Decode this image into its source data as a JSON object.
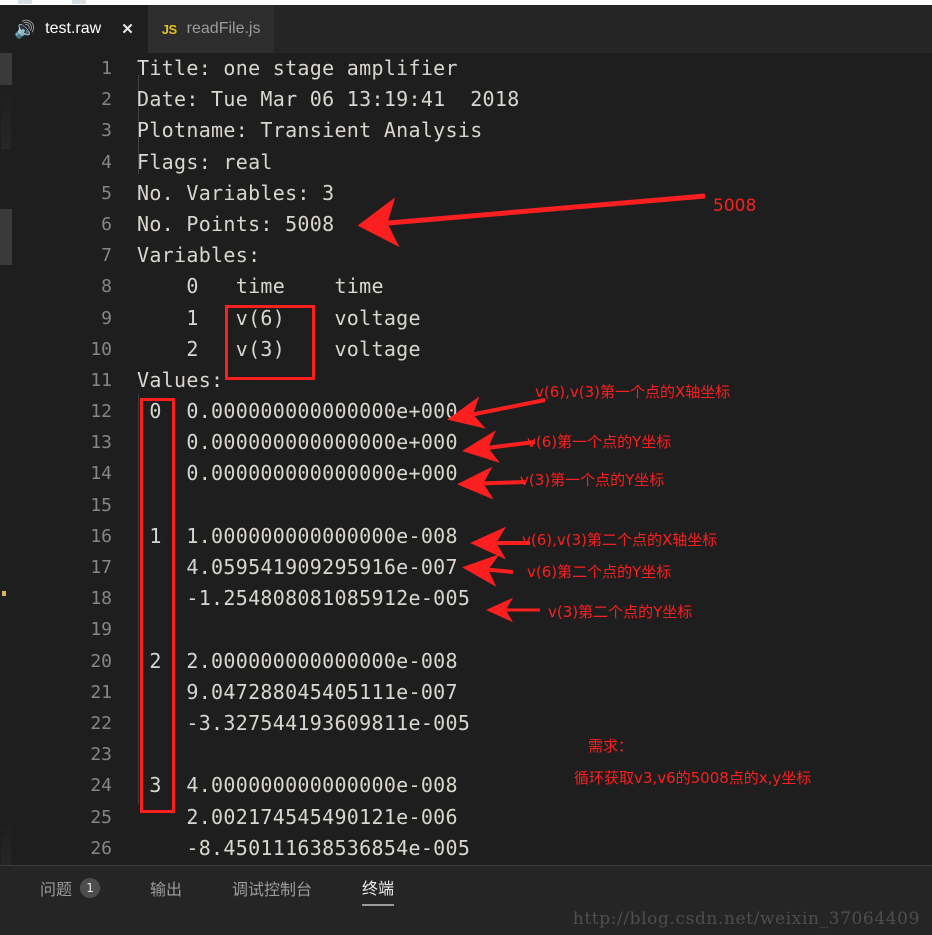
{
  "window": {
    "tabs": [
      {
        "label": "test.raw",
        "icon": "speaker-icon",
        "active": true,
        "close": "✕"
      },
      {
        "label": "readFile.js",
        "icon": "js-icon",
        "icon_text": "JS",
        "active": false
      }
    ]
  },
  "editor": {
    "lines": [
      {
        "no": "1",
        "text": "Title: one stage amplifier"
      },
      {
        "no": "2",
        "text": "Date: Tue Mar 06 13:19:41  2018"
      },
      {
        "no": "3",
        "text": "Plotname: Transient Analysis"
      },
      {
        "no": "4",
        "text": "Flags: real"
      },
      {
        "no": "5",
        "text": "No. Variables: 3"
      },
      {
        "no": "6",
        "text": "No. Points: 5008"
      },
      {
        "no": "7",
        "text": "Variables:"
      },
      {
        "no": "8",
        "text": "    0   time    time"
      },
      {
        "no": "9",
        "text": "    1   v(6)    voltage"
      },
      {
        "no": "10",
        "text": "    2   v(3)    voltage"
      },
      {
        "no": "11",
        "text": "Values:"
      },
      {
        "no": "12",
        "text": " 0  0.000000000000000e+000"
      },
      {
        "no": "13",
        "text": "    0.000000000000000e+000"
      },
      {
        "no": "14",
        "text": "    0.000000000000000e+000"
      },
      {
        "no": "15",
        "text": ""
      },
      {
        "no": "16",
        "text": " 1  1.000000000000000e-008"
      },
      {
        "no": "17",
        "text": "    4.059541909295916e-007"
      },
      {
        "no": "18",
        "text": "    -1.254808081085912e-005"
      },
      {
        "no": "19",
        "text": ""
      },
      {
        "no": "20",
        "text": " 2  2.000000000000000e-008"
      },
      {
        "no": "21",
        "text": "    9.047288045405111e-007"
      },
      {
        "no": "22",
        "text": "    -3.327544193609811e-005"
      },
      {
        "no": "23",
        "text": ""
      },
      {
        "no": "24",
        "text": " 3  4.000000000000000e-008"
      },
      {
        "no": "25",
        "text": "    2.002174545490121e-006"
      },
      {
        "no": "26",
        "text": "    -8.450111638536854e-005"
      }
    ]
  },
  "annotations": {
    "points_count": "5008",
    "first_x": "v(6),v(3)第一个点的X轴坐标",
    "first_y_v6": "v(6)第一个点的Y坐标",
    "first_y_v3": "v(3)第一个点的Y坐标",
    "second_x": "v(6),v(3)第二个点的X轴坐标",
    "second_y_v6": "v(6)第二个点的Y坐标",
    "second_y_v3": "v(3)第二个点的Y坐标",
    "requirement_title": "需求：",
    "requirement_body": "循环获取v3,v6的5008点的x,y坐标",
    "color": "#fb1f1f"
  },
  "panel": {
    "tabs": [
      {
        "label": "问题",
        "badge": "1",
        "active": false
      },
      {
        "label": "输出",
        "active": false
      },
      {
        "label": "调试控制台",
        "active": false
      },
      {
        "label": "终端",
        "active": true
      }
    ]
  },
  "watermark": {
    "text": "http://blog.csdn.net/weixin_37064409"
  }
}
